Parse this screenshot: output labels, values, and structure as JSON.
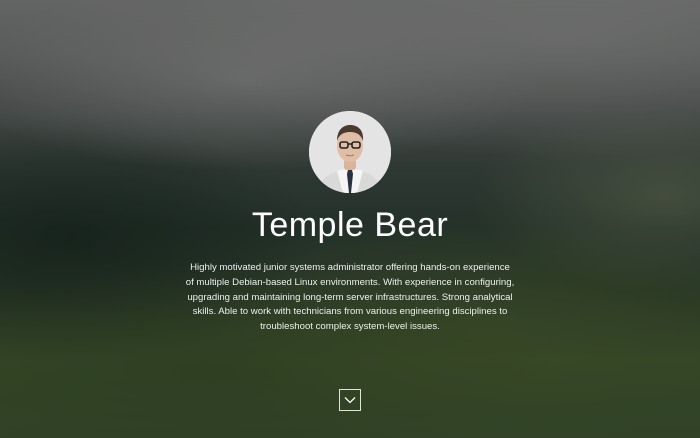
{
  "hero": {
    "name": "Temple Bear",
    "bio": "Highly motivated junior systems administrator offering hands-on experience of multiple Debian-based Linux environments. With experience in configuring, upgrading and maintaining long-term server infrastructures. Strong analytical skills. Able to work with technicians from various engineering disciplines to troubleshoot complex system-level issues.",
    "scroll_icon": "chevron-down-icon"
  }
}
